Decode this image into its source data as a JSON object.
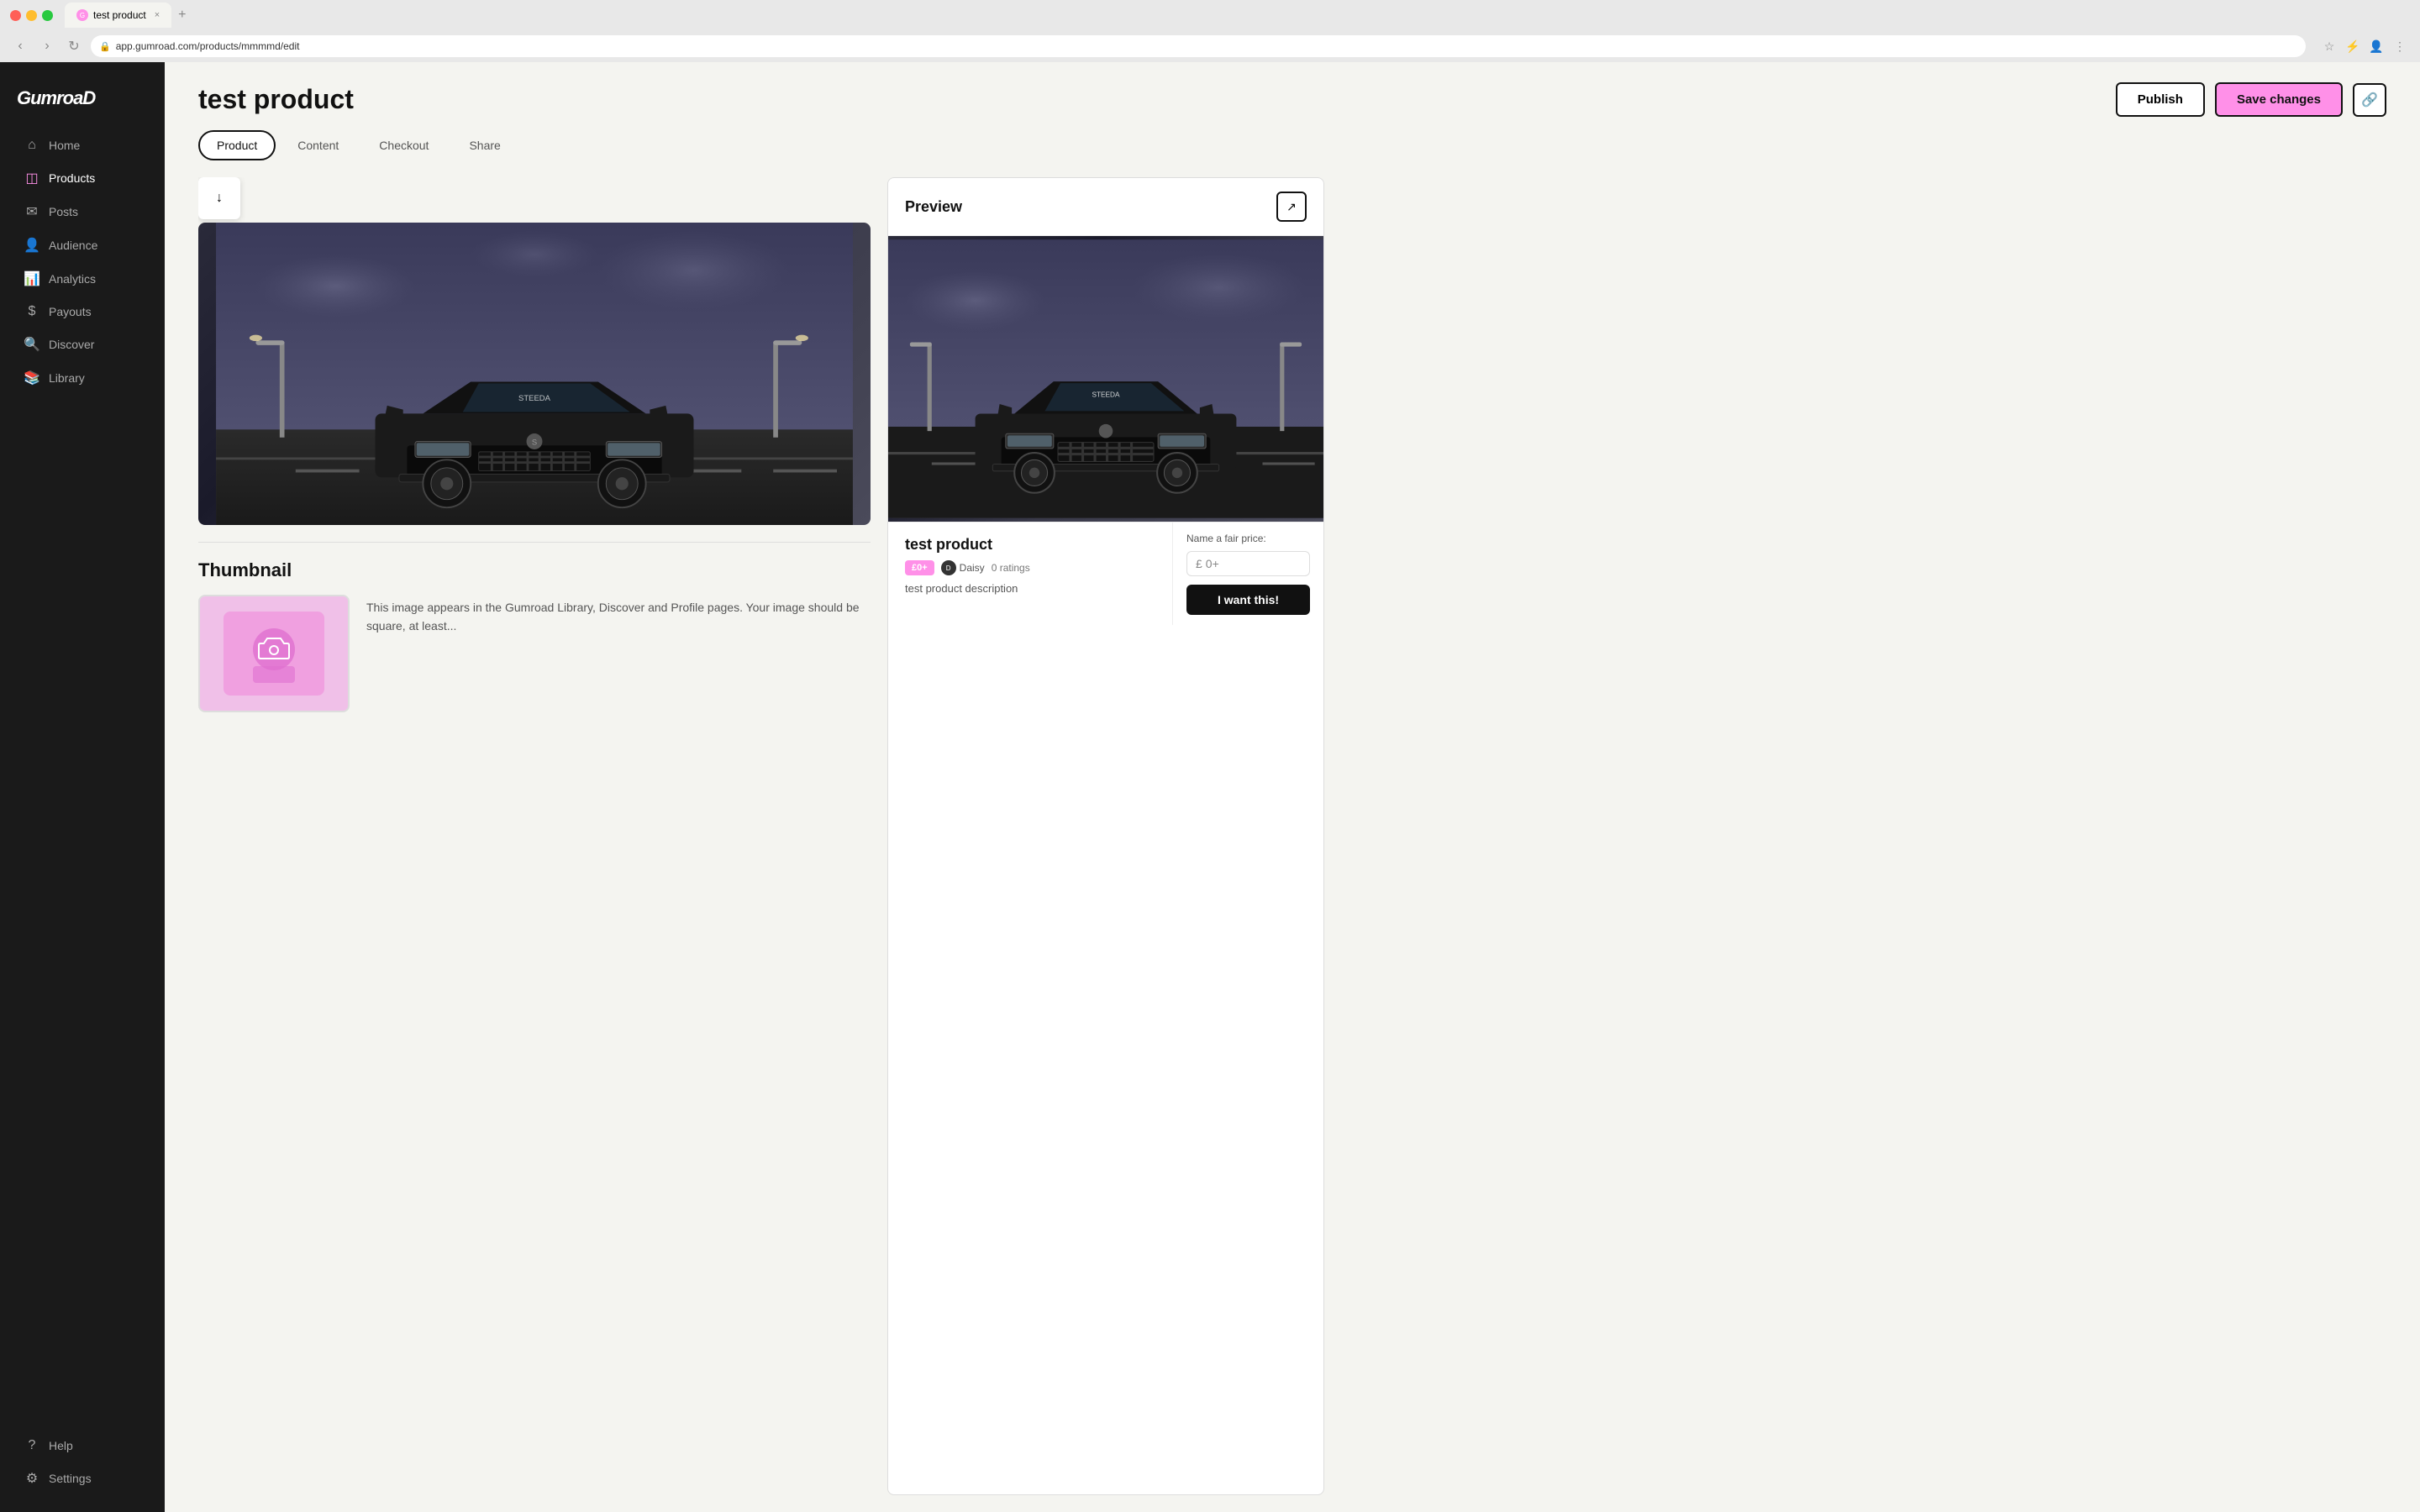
{
  "browser": {
    "tab_title": "test product",
    "url": "app.gumroad.com/products/mmmmd/edit",
    "tab_close": "×",
    "tab_new": "+"
  },
  "sidebar": {
    "logo": "GumroaD",
    "items": [
      {
        "id": "home",
        "label": "Home",
        "icon": "⌂"
      },
      {
        "id": "products",
        "label": "Products",
        "icon": "◫",
        "active": true
      },
      {
        "id": "posts",
        "label": "Posts",
        "icon": "✉"
      },
      {
        "id": "audience",
        "label": "Audience",
        "icon": "👤"
      },
      {
        "id": "analytics",
        "label": "Analytics",
        "icon": "📊"
      },
      {
        "id": "payouts",
        "label": "Payouts",
        "icon": "$"
      },
      {
        "id": "discover",
        "label": "Discover",
        "icon": "🔍"
      },
      {
        "id": "library",
        "label": "Library",
        "icon": "📚"
      }
    ],
    "bottom_items": [
      {
        "id": "help",
        "label": "Help",
        "icon": "?"
      },
      {
        "id": "settings",
        "label": "Settings",
        "icon": "⚙"
      }
    ]
  },
  "header": {
    "product_name": "test product",
    "publish_label": "Publish",
    "save_label": "Save changes",
    "link_icon": "🔗"
  },
  "tabs": [
    {
      "id": "product",
      "label": "Product",
      "active": true
    },
    {
      "id": "content",
      "label": "Content"
    },
    {
      "id": "checkout",
      "label": "Checkout"
    },
    {
      "id": "share",
      "label": "Share"
    }
  ],
  "editor": {
    "thumbnail_title": "Thumbnail",
    "thumbnail_desc": "This image appears in the Gumroad Library, Discover and Profile pages. Your image should be square, at least..."
  },
  "preview": {
    "title": "Preview",
    "product_title": "test product",
    "price": "£0+",
    "seller_name": "Daisy",
    "ratings": "0 ratings",
    "description": "test product description",
    "price_label": "Name a fair price:",
    "currency_symbol": "£",
    "price_placeholder": "0+",
    "want_button": "I want this!"
  }
}
